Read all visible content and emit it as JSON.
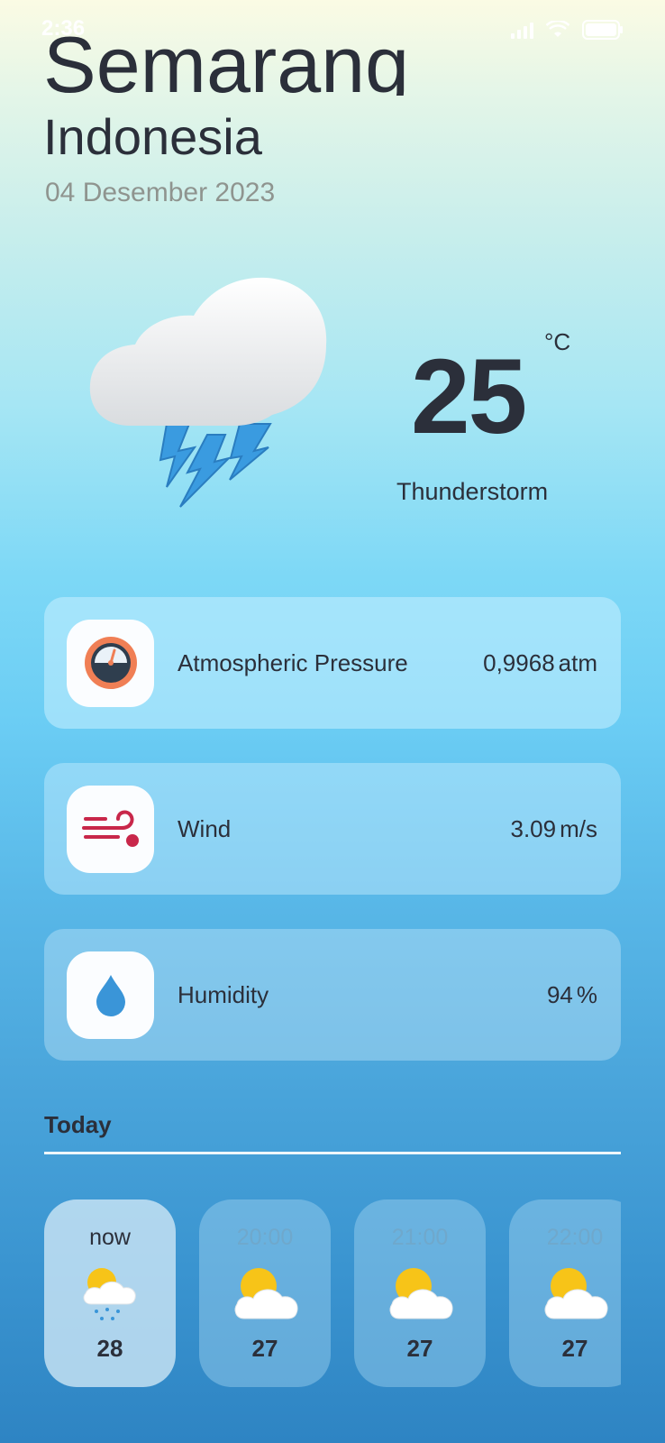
{
  "status": {
    "time": "2:36"
  },
  "location": {
    "city": "Semarang",
    "country": "Indonesia",
    "date": "04 Desember 2023"
  },
  "current": {
    "temperature": "25",
    "unit": "°C",
    "condition": "Thunderstorm",
    "icon": "thunderstorm-cloud-icon"
  },
  "details": [
    {
      "label": "Atmospheric Pressure",
      "value": "0,9968",
      "unit": "atm",
      "icon": "pressure-gauge-icon"
    },
    {
      "label": "Wind",
      "value": "3.09",
      "unit": "m/s",
      "icon": "wind-icon"
    },
    {
      "label": "Humidity",
      "value": "94",
      "unit": "%",
      "icon": "water-drop-icon"
    }
  ],
  "today": {
    "label": "Today",
    "hours": [
      {
        "time": "now",
        "temp": "28",
        "icon": "partly-cloudy-rain-icon",
        "active": true
      },
      {
        "time": "20:00",
        "temp": "27",
        "icon": "partly-cloudy-icon",
        "active": false
      },
      {
        "time": "21:00",
        "temp": "27",
        "icon": "partly-cloudy-icon",
        "active": false
      },
      {
        "time": "22:00",
        "temp": "27",
        "icon": "partly-cloudy-icon",
        "active": false
      }
    ]
  },
  "colors": {
    "text": "#2b2f3a",
    "lightning": "#3a9be0",
    "sun": "#f7c418",
    "wind": "#c8274a",
    "drop": "#3a95d8",
    "gauge": "#f07f55"
  }
}
